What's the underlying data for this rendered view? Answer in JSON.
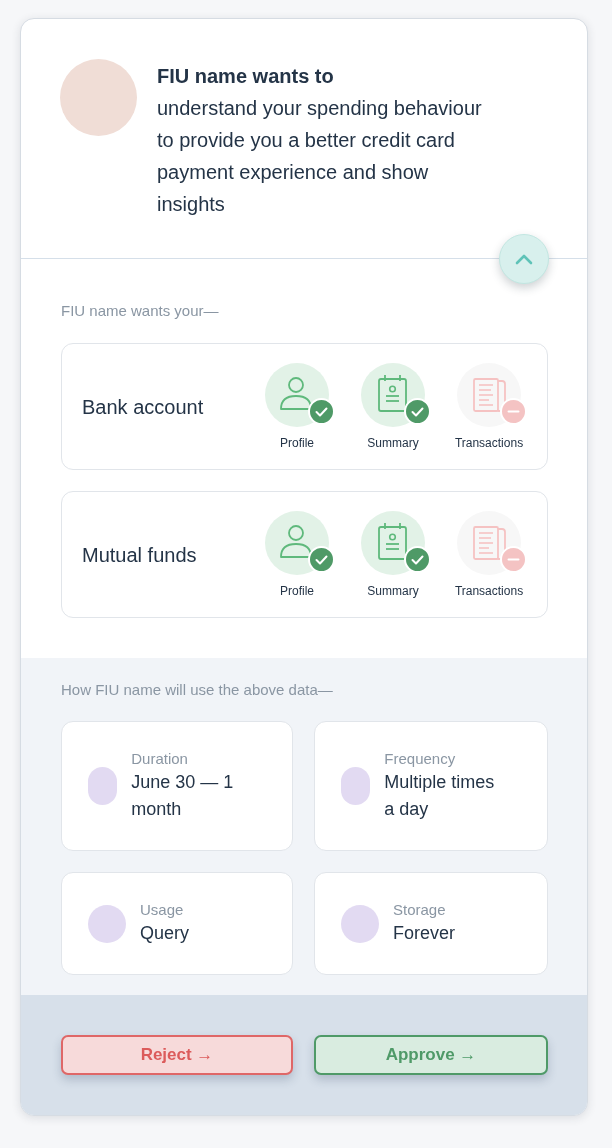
{
  "header": {
    "title": "FIU name wants to",
    "purpose": "understand your spending behaviour to provide you a better credit card payment experience and show insights",
    "expanded": true
  },
  "data_request": {
    "heading": "FIU name wants your—",
    "accounts": [
      {
        "name": "Bank account",
        "items": [
          {
            "kind": "profile",
            "label": "Profile",
            "allowed": true
          },
          {
            "kind": "summary",
            "label": "Summary",
            "allowed": true
          },
          {
            "kind": "transactions",
            "label": "Transactions",
            "allowed": false
          }
        ]
      },
      {
        "name": "Mutual funds",
        "items": [
          {
            "kind": "profile",
            "label": "Profile",
            "allowed": true
          },
          {
            "kind": "summary",
            "label": "Summary",
            "allowed": true
          },
          {
            "kind": "transactions",
            "label": "Transactions",
            "allowed": false
          }
        ]
      }
    ]
  },
  "usage": {
    "heading": "How FIU name will use the above data—",
    "details": [
      {
        "label": "Duration",
        "value": "June 30 — 1 month"
      },
      {
        "label": "Frequency",
        "value": "Multiple times a day"
      },
      {
        "label": "Usage",
        "value": "Query"
      },
      {
        "label": "Storage",
        "value": "Forever"
      }
    ]
  },
  "actions": [
    {
      "kind": "reject",
      "label": "Reject →"
    },
    {
      "kind": "approve",
      "label": "Approve →"
    }
  ]
}
